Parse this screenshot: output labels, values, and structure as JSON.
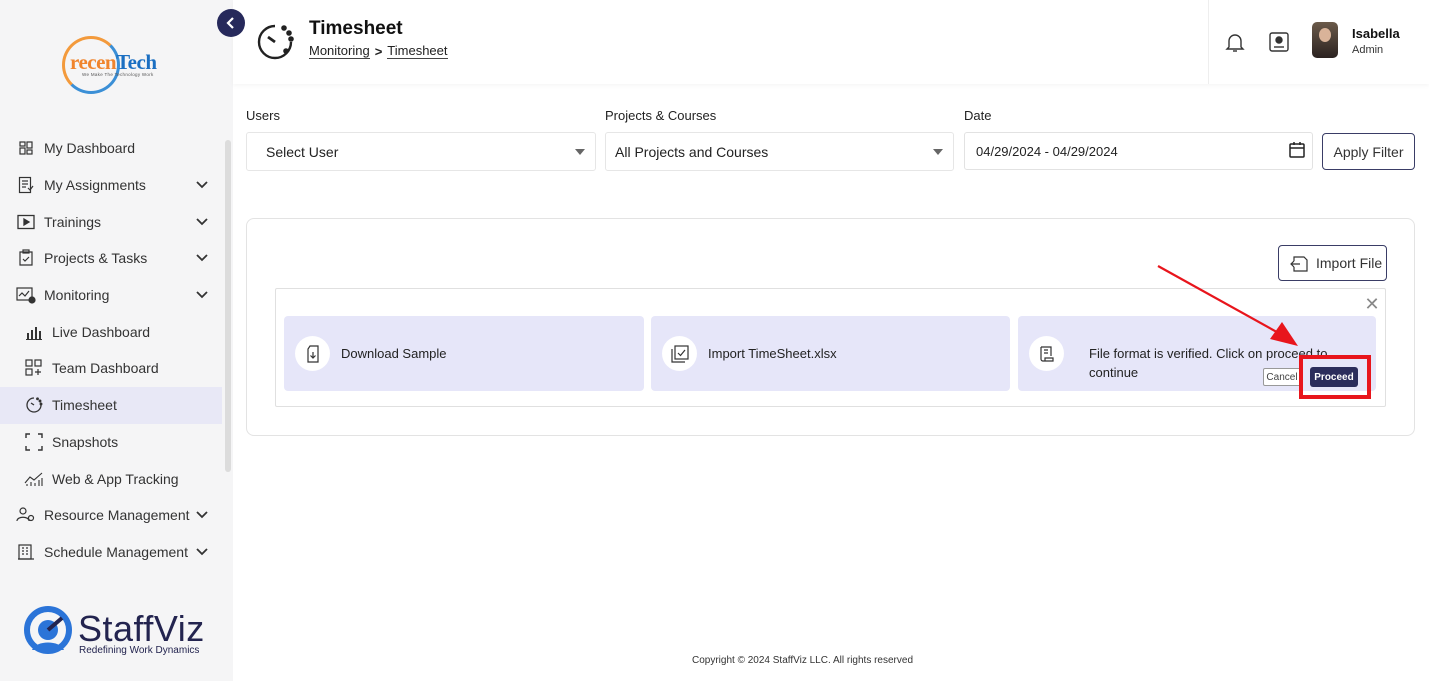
{
  "sidebar": {
    "logo": {
      "text_a": "recen",
      "text_b": "Tech",
      "tagline": "We Make The Technology Work"
    },
    "items": [
      {
        "label": "My Dashboard",
        "icon": "dashboard-grid-icon"
      },
      {
        "label": "My Assignments",
        "icon": "assignment-icon",
        "expandable": true
      },
      {
        "label": "Trainings",
        "icon": "play-icon",
        "expandable": true
      },
      {
        "label": "Projects & Tasks",
        "icon": "clipboard-check-icon",
        "expandable": true
      },
      {
        "label": "Monitoring",
        "icon": "monitoring-icon",
        "expandable": true,
        "expanded": true
      },
      {
        "label": "Live Dashboard",
        "icon": "bar-chart-icon",
        "sub": true
      },
      {
        "label": "Team Dashboard",
        "icon": "grid-plus-icon",
        "sub": true
      },
      {
        "label": "Timesheet",
        "icon": "timer-icon",
        "sub": true,
        "active": true
      },
      {
        "label": "Snapshots",
        "icon": "frame-corners-icon",
        "sub": true
      },
      {
        "label": "Web & App Tracking",
        "icon": "trend-icon",
        "sub": true
      },
      {
        "label": "Resource Management",
        "icon": "people-gear-icon",
        "expandable": true
      },
      {
        "label": "Schedule Management",
        "icon": "building-icon",
        "expandable": true
      }
    ],
    "brand": {
      "name": "StaffViz",
      "tagline": "Redefining Work Dynamics"
    }
  },
  "header": {
    "title": "Timesheet",
    "breadcrumb": [
      "Monitoring",
      "Timesheet"
    ],
    "user": {
      "name": "Isabella",
      "role": "Admin"
    }
  },
  "filters": {
    "users": {
      "label": "Users",
      "value": "Select User"
    },
    "projects": {
      "label": "Projects & Courses",
      "value": "All Projects and Courses"
    },
    "date": {
      "label": "Date",
      "value": "04/29/2024 - 04/29/2024"
    },
    "apply_label": "Apply Filter"
  },
  "import": {
    "button_label": "Import File",
    "steps": [
      {
        "label": "Download Sample",
        "icon": "download-file-icon"
      },
      {
        "label": "Import TimeSheet.xlsx",
        "icon": "checkbox-file-icon"
      },
      {
        "label": "File format is verified. Click on proceed to continue",
        "icon": "document-lines-icon"
      }
    ],
    "cancel_label": "Cancel",
    "proceed_label": "Proceed",
    "close_symbol": "✕"
  },
  "footer": {
    "copyright": "Copyright © 2024 StaffViz LLC. All rights reserved"
  },
  "colors": {
    "accent": "#2b2d5c",
    "annotation": "#e8151c",
    "step_bg": "#e6e6f9",
    "sidebar_bg": "#f5f5f6"
  }
}
